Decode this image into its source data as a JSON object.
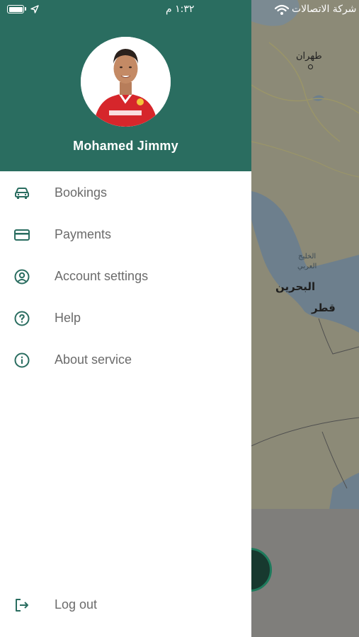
{
  "status_bar": {
    "time": "١:٣٢ م",
    "carrier": "شركة الاتصالات",
    "icons": [
      "battery-icon",
      "location-arrow-icon",
      "wifi-icon"
    ]
  },
  "map": {
    "labels": {
      "city_1": "طهران",
      "city_2": "البحرين",
      "city_3": "قطر",
      "gulf_line_1": "الخليج",
      "gulf_line_2": "العربي"
    }
  },
  "drawer": {
    "header_color": "#2a6d60",
    "user_name": "Mohamed Jimmy",
    "menu": [
      {
        "label": "Bookings",
        "icon": "car-icon"
      },
      {
        "label": "Payments",
        "icon": "credit-card-icon"
      },
      {
        "label": "Account settings",
        "icon": "user-circle-icon"
      },
      {
        "label": "Help",
        "icon": "help-circle-icon"
      },
      {
        "label": "About service",
        "icon": "info-circle-icon"
      }
    ],
    "logout": {
      "label": "Log out",
      "icon": "logout-icon"
    }
  }
}
